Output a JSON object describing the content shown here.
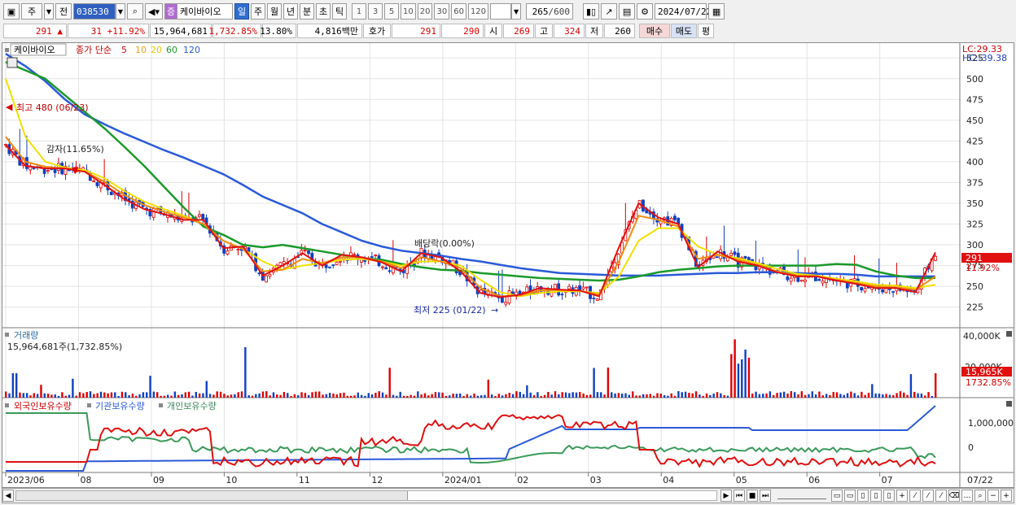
{
  "toolbar": {
    "tab_main": "주",
    "tab_all": "전",
    "stock_code": "038530",
    "stock_name": "케이바이오",
    "stock_name_tag": "증",
    "periods": [
      "일",
      "주",
      "월",
      "년",
      "분",
      "초",
      "틱"
    ],
    "active_period": "일",
    "intervals": [
      "1",
      "3",
      "5",
      "10",
      "20",
      "30",
      "60",
      "120"
    ],
    "count_value": "265",
    "count_total": "/600",
    "date": "2024/07/22"
  },
  "quote": {
    "price": "291",
    "change_arrow": "▲",
    "change": "31",
    "change_pct": "+11.92%",
    "volume": "15,964,681",
    "volume_pct": "1,732.85%",
    "turnover": "13.80%",
    "amount": "4,816백만",
    "hoga_label": "호가",
    "ask": "291",
    "bid": "290",
    "open_label": "시",
    "open": "269",
    "high_label": "고",
    "high": "324",
    "low_label": "저",
    "low": "260",
    "buy_label": "매수",
    "sell_label": "매도",
    "eval_label": "평"
  },
  "legend": {
    "name": "케이바이오",
    "series_label": "종가 단순",
    "ma5": "5",
    "ma10": "10",
    "ma20": "20",
    "ma60": "60",
    "ma120": "120"
  },
  "annotations": {
    "high": "최고 480 (06/23)",
    "reduction": "감자(11.65%)",
    "dividend": "배당락(0.00%)",
    "low": "최저 225 (01/22)"
  },
  "right_labels": {
    "lc": "LC:29.33",
    "hc": "HC:-39.38",
    "price_tag": "291",
    "pct_tag": "11.92%",
    "vol_tag": "15,965K",
    "vol_pct_tag": "1732.85%"
  },
  "volume_panel": {
    "title": "거래량",
    "value": "15,964,681주(1,732.85%)",
    "axis": [
      "40,000K",
      "20,000K"
    ]
  },
  "holding_panel": {
    "foreign": "외국인보유수량",
    "institution": "기관보유수량",
    "individual": "개인보유수량",
    "axis": [
      "1,000,000",
      "0"
    ]
  },
  "colors": {
    "ma5": "#e01010",
    "ma10": "#f08c10",
    "ma20": "#f0e000",
    "ma60": "#1a9a2a",
    "ma120": "#2a5ad8",
    "up": "#e00000",
    "down": "#1040c0",
    "foreign": "#e01010",
    "institution": "#2a5ad8",
    "individual": "#3a9a5a"
  },
  "chart_data": {
    "type": "line",
    "title": "",
    "y_ticks": [
      225,
      250,
      275,
      300,
      325,
      350,
      375,
      400,
      425,
      450,
      475,
      500,
      525
    ],
    "x_labels": [
      "2023/06",
      "08",
      "09",
      "10",
      "11",
      "12",
      "2024/01",
      "02",
      "03",
      "04",
      "05",
      "06",
      "07",
      "07/22"
    ],
    "series": [
      {
        "name": "5",
        "values": [
          420,
          395,
          392,
          392,
          388,
          372,
          355,
          343,
          337,
          330,
          330,
          296,
          298,
          263,
          275,
          290,
          275,
          288,
          285,
          279,
          268,
          290,
          285,
          268,
          242,
          237,
          240,
          248,
          246,
          245,
          238,
          297,
          350,
          333,
          325,
          273,
          292,
          280,
          275,
          267,
          262,
          262,
          257,
          253,
          248,
          248,
          243,
          291
        ]
      },
      {
        "name": "10",
        "values": [
          430,
          400,
          394,
          392,
          388,
          376,
          360,
          348,
          340,
          333,
          325,
          305,
          295,
          268,
          270,
          283,
          278,
          285,
          285,
          280,
          272,
          285,
          280,
          272,
          248,
          238,
          239,
          245,
          246,
          245,
          240,
          280,
          335,
          330,
          322,
          283,
          288,
          282,
          276,
          268,
          263,
          262,
          258,
          254,
          250,
          249,
          246,
          262
        ]
      },
      {
        "name": "20",
        "values": [
          500,
          430,
          400,
          393,
          390,
          380,
          365,
          352,
          343,
          335,
          325,
          305,
          295,
          280,
          270,
          275,
          278,
          282,
          283,
          280,
          275,
          280,
          280,
          275,
          258,
          243,
          238,
          242,
          244,
          244,
          242,
          262,
          305,
          320,
          320,
          298,
          288,
          284,
          278,
          271,
          265,
          263,
          259,
          256,
          252,
          251,
          248,
          252
        ]
      },
      {
        "name": "60",
        "values": [
          520,
          510,
          500,
          480,
          460,
          440,
          418,
          395,
          370,
          345,
          322,
          312,
          300,
          297,
          300,
          296,
          292,
          288,
          284,
          282,
          277,
          273,
          270,
          269,
          266,
          264,
          262,
          260,
          259,
          258,
          257,
          258,
          262,
          267,
          270,
          272,
          274,
          275,
          275,
          275,
          275,
          275,
          277,
          276,
          268,
          263,
          260,
          260
        ]
      },
      {
        "name": "120",
        "values": [
          530,
          515,
          497,
          475,
          457,
          445,
          434,
          424,
          414,
          405,
          395,
          385,
          372,
          358,
          348,
          338,
          325,
          315,
          305,
          298,
          293,
          290,
          287,
          283,
          280,
          276,
          272,
          269,
          266,
          265,
          264,
          263,
          263,
          263,
          264,
          265,
          266,
          266,
          267,
          267,
          266,
          265,
          265,
          264,
          262,
          262,
          262,
          262
        ]
      }
    ],
    "ylim": [
      210,
      535
    ]
  }
}
